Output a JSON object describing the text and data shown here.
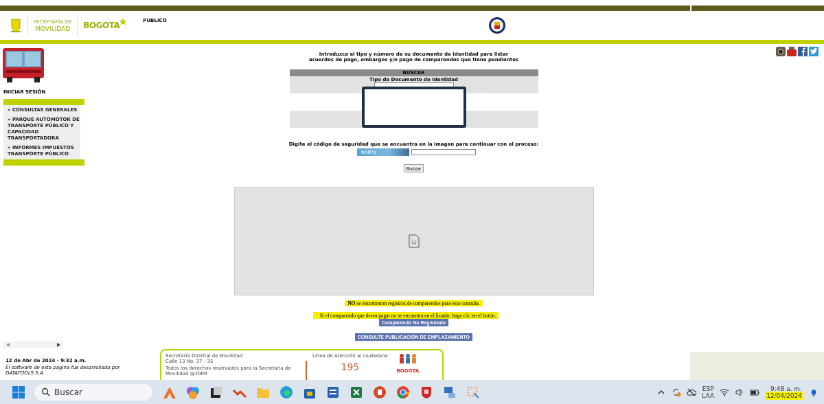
{
  "header": {
    "logo_small": "SECRETARÍA DE",
    "logo_main": "MOVILIDAD",
    "city_logo": "BOGOTA",
    "section_link": "PUBLICO"
  },
  "sidebar": {
    "login": "INICIAR SESIÓN",
    "menu": [
      {
        "label": "» CONSULTAS GENERALES"
      },
      {
        "label": "» PARQUE AUTOMOTOR DE TRANSPORTE PÚBLICO Y CAPACIDAD TRANSPORTADORA"
      },
      {
        "label": "» INFORMES IMPUESTOS TRANSPORTE PÚBLICO"
      }
    ],
    "date": "12 de Abr de 2024 - 9:32 a.m.",
    "credit": "El software de esta página fue desarrollado por DATATOOLS S.A."
  },
  "form": {
    "intro_lines": [
      "Introduzca el tipo y número de su documento de identidad para listar",
      "acuerdos de pago, embargos y/o pago de comparendos que tiene pendientes"
    ],
    "table_title": "BUSCAR",
    "doc_type_label": "Tipo de Documento de Identidad",
    "captcha_prompt": "Digite el código de seguridad que se encuentra en la imagen para continuar con el proceso:",
    "captcha_code": "hKfPo",
    "submit": "Buscar"
  },
  "results": {
    "no_records": "**NO** se encontraron registros de comparendos para esta consulta.",
    "hint": "Si el comparendo que desea pagar no se encuentra en el listado, haga clic en el botón.",
    "unregistered_button": "Comparendo No Registrado",
    "publication_button": "CONSULTE PUBLICACIÓN DE EMPLAZAMIENTO"
  },
  "footer": {
    "entity": "Secretaría Distrital de Movilidad",
    "address": "Calle 13 No. 37 - 35",
    "rights": "Todos los derechos reservados para la Secretaría de Movilidad @2009",
    "line_label": "Línea de Atención al ciudadano",
    "line_number": "195",
    "city_logo": "BOGOTA"
  },
  "taskbar": {
    "search_placeholder": "Buscar",
    "language": "ESP",
    "layout": "LAA",
    "time": "9:48 a. m.",
    "date": "12/04/2024"
  }
}
